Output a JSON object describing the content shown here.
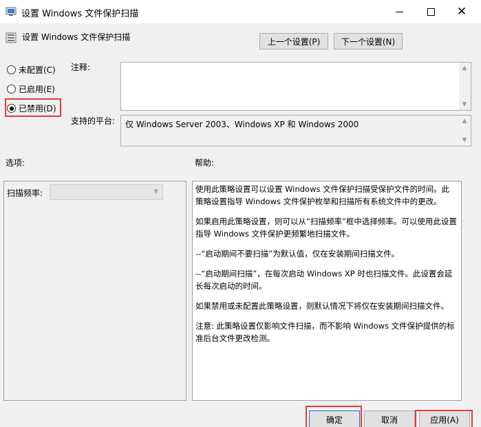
{
  "window": {
    "title": "设置 Windows 文件保护扫描",
    "controls": {
      "minimize": "minimize-icon",
      "maximize": "maximize-icon",
      "close": "close-icon"
    }
  },
  "header": {
    "setting_name": "设置 Windows 文件保护扫描",
    "prev_button": "上一个设置(P)",
    "next_button": "下一个设置(N)"
  },
  "state": {
    "options": [
      {
        "label": "未配置(C)",
        "checked": false
      },
      {
        "label": "已启用(E)",
        "checked": false
      },
      {
        "label": "已禁用(D)",
        "checked": true
      }
    ]
  },
  "comment": {
    "label": "注释:",
    "value": ""
  },
  "platform": {
    "label": "支持的平台:",
    "value": "仅 Windows Server 2003、Windows XP 和 Windows 2000"
  },
  "options_section": {
    "label": "选项:",
    "frequency_label": "扫描频率:",
    "frequency_value": ""
  },
  "help_section": {
    "label": "帮助:",
    "paragraphs": [
      "使用此策略设置可以设置 Windows 文件保护扫描受保护文件的时间。此策略设置指导 Windows 文件保护枚举和扫描所有系统文件中的更改。",
      "如果启用此策略设置，则可以从“扫描频率”框中选择频率。可以使用此设置指导 Windows 文件保护更频繁地扫描文件。",
      "--“启动期间不要扫描”为默认值，仅在安装期间扫描文件。",
      "--“启动期间扫描”，在每次启动 Windows XP 时也扫描文件。此设置会延长每次启动的时间。",
      "如果禁用或未配置此策略设置，则默认情况下将仅在安装期间扫描文件。",
      "注意: 此策略设置仅影响文件扫描，而不影响 Windows 文件保护提供的标准后台文件更改检测。"
    ]
  },
  "footer": {
    "ok": "确定",
    "cancel": "取消",
    "apply": "应用(A)"
  },
  "colors": {
    "highlight_red": "#e43b3b",
    "focus_blue": "#0078d7"
  }
}
